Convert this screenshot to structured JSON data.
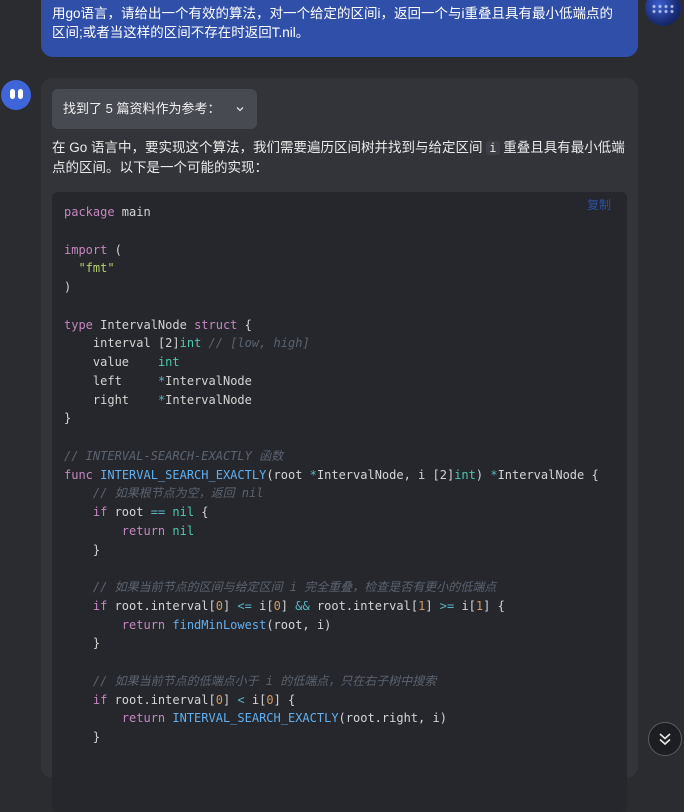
{
  "user_message": {
    "text": "用go语言，请给出一个有效的算法，对一个给定的区间i，返回一个与i重叠且具有最小低端点的区间;或者当这样的区间不存在时返回T.nil。"
  },
  "answer": {
    "references_label": "找到了 5 篇资料作为参考：",
    "intro_before": "在 Go 语言中，要实现这个算法，我们需要遍历区间树并找到与给定区间 ",
    "intro_code": "i",
    "intro_after": " 重叠且具有最小低端点的区间。以下是一个可能的实现：",
    "copy_label": "复制",
    "code": {
      "l1_kw": "package",
      "l1_rest": " main",
      "l3_kw": "import",
      "l3_rest": " (",
      "l4_str": "\"fmt\"",
      "l5": ")",
      "l7_kw": "type",
      "l7_name": " IntervalNode ",
      "l7_kw2": "struct",
      "l7_rest": " {",
      "l8_name": "interval ",
      "l8_type_a": "[2]",
      "l8_type_b": "int",
      "l8_cm": " // [low, high]",
      "l9_name": "value    ",
      "l9_type": "int",
      "l10_name": "left     ",
      "l10_star": "*",
      "l10_type": "IntervalNode",
      "l11_name": "right    ",
      "l11_star": "*",
      "l11_type": "IntervalNode",
      "l12": "}",
      "l14_cm": "// INTERVAL-SEARCH-EXACTLY 函数",
      "l15_kw": "func",
      "l15_fn": "INTERVAL_SEARCH_EXACTLY",
      "l15_a": "(root ",
      "l15_star": "*",
      "l15_b": "IntervalNode, i ",
      "l15_arr": "[2]",
      "l15_int": "int",
      "l15_c": ") ",
      "l15_star2": "*",
      "l15_d": "IntervalNode {",
      "l16_cm": "// 如果根节点为空，返回 nil",
      "l17_kw": "if",
      "l17_a": " root ",
      "l17_op": "==",
      "l17_nil": " nil",
      "l17_b": " {",
      "l18_kw": "return",
      "l18_nil": " nil",
      "l19": "}",
      "l21_cm": "// 如果当前节点的区间与给定区间 i 完全重叠，检查是否有更小的低端点",
      "l22_kw": "if",
      "l22_a": " root.interval[",
      "l22_n0": "0",
      "l22_b": "] ",
      "l22_op1": "<=",
      "l22_c": " i[",
      "l22_n1": "0",
      "l22_d": "] ",
      "l22_op2": "&&",
      "l22_e": " root.interval[",
      "l22_n2": "1",
      "l22_f": "] ",
      "l22_op3": ">=",
      "l22_g": " i[",
      "l22_n3": "1",
      "l22_h": "] {",
      "l23_kw": "return",
      "l23_fn": " findMinLowest",
      "l23_rest": "(root, i)",
      "l24": "}",
      "l26_cm": "// 如果当前节点的低端点小于 i 的低端点，只在右子树中搜索",
      "l27_kw": "if",
      "l27_a": " root.interval[",
      "l27_n0": "0",
      "l27_b": "] ",
      "l27_op": "<",
      "l27_c": " i[",
      "l27_n1": "0",
      "l27_d": "] {",
      "l28_kw": "return",
      "l28_fn": " INTERVAL_SEARCH_EXACTLY",
      "l28_rest": "(root.right, i)",
      "l29": "}"
    }
  },
  "icons": {
    "references_chevron": "chevron-down-icon",
    "scroll_down": "double-chevron-down-icon"
  },
  "colors": {
    "user_bubble": "#2f4fa8",
    "card": "#33343a",
    "code_bg": "#25272c",
    "copy": "#2d51a0"
  }
}
